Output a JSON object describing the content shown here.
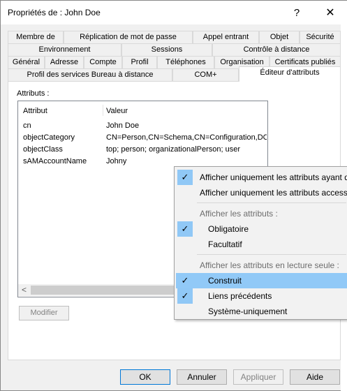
{
  "window": {
    "title": "Propriétés de : John Doe",
    "help_glyph": "?",
    "close_glyph": "✕"
  },
  "tabs": {
    "row1": [
      "Membre de",
      "Réplication de mot de passe",
      "Appel entrant",
      "Objet",
      "Sécurité"
    ],
    "row2": [
      "Environnement",
      "Sessions",
      "Contrôle à distance"
    ],
    "row3": [
      "Général",
      "Adresse",
      "Compte",
      "Profil",
      "Téléphones",
      "Organisation",
      "Certificats publiés"
    ],
    "row4": [
      "Profil des services Bureau à distance",
      "COM+",
      "Éditeur d'attributs"
    ],
    "active": "Éditeur d'attributs"
  },
  "attributes": {
    "label": "Attributs :",
    "columns": [
      "Attribut",
      "Valeur"
    ],
    "rows": [
      {
        "name": "cn",
        "value": "John Doe"
      },
      {
        "name": "objectCategory",
        "value": "CN=Person,CN=Schema,CN=Configuration,DC="
      },
      {
        "name": "objectClass",
        "value": "top; person; organizationalPerson; user"
      },
      {
        "name": "sAMAccountName",
        "value": "Johny"
      }
    ],
    "scroll_left_glyph": "<"
  },
  "buttons": {
    "modify": "Modifier",
    "ok": "OK",
    "cancel": "Annuler",
    "apply": "Appliquer",
    "help": "Aide"
  },
  "context_menu": {
    "items": [
      {
        "label": "Afficher uniquement les attributs ayant d",
        "checked": true,
        "type": "item"
      },
      {
        "label": "Afficher uniquement les attributs access",
        "checked": false,
        "type": "item"
      },
      {
        "label": "Afficher les attributs :",
        "type": "header"
      },
      {
        "label": "Obligatoire",
        "checked": true,
        "type": "subitem"
      },
      {
        "label": "Facultatif",
        "checked": false,
        "type": "subitem"
      },
      {
        "label": "Afficher les attributs en lecture seule :",
        "type": "header"
      },
      {
        "label": "Construit",
        "checked": true,
        "type": "subitem",
        "highlighted": true
      },
      {
        "label": "Liens précédents",
        "checked": true,
        "type": "subitem"
      },
      {
        "label": "Système-uniquement",
        "checked": false,
        "type": "subitem"
      }
    ],
    "check_glyph": "✓"
  },
  "colors": {
    "highlight": "#91c9f7",
    "check_bg": "#90c8f6",
    "default_button_border": "#0078d7"
  }
}
